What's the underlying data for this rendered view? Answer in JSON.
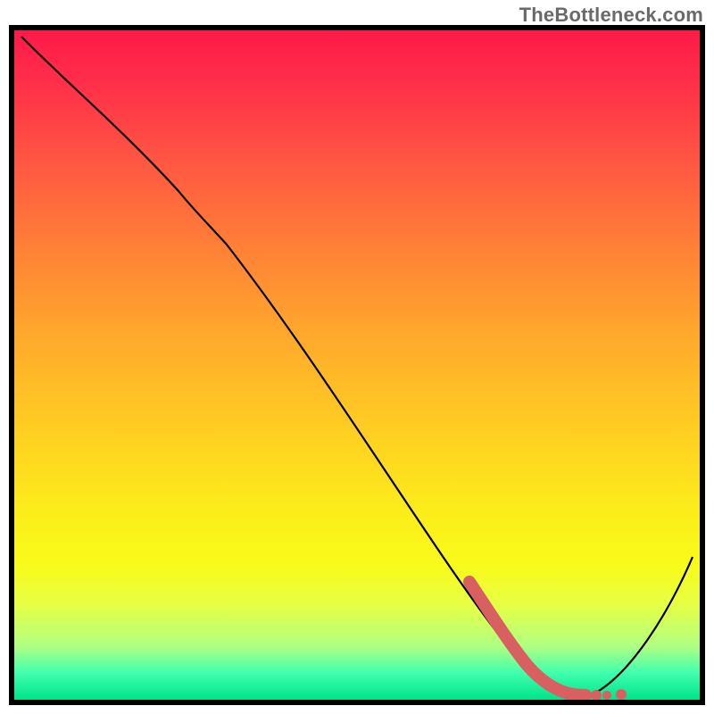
{
  "watermark": "TheBottleneck.com",
  "chart_data": {
    "type": "line",
    "title": "",
    "xlabel": "",
    "ylabel": "",
    "xlim": [
      0,
      100
    ],
    "ylim": [
      0,
      100
    ],
    "grid": false,
    "legend": false,
    "series": [
      {
        "name": "curve",
        "x": [
          1,
          12,
          24,
          36,
          48,
          60,
          72,
          78,
          82,
          86,
          100
        ],
        "y": [
          99,
          87,
          76,
          62,
          45,
          28,
          11,
          3,
          0,
          0,
          22
        ]
      },
      {
        "name": "highlight-band",
        "x": [
          67,
          74,
          78,
          82
        ],
        "y": [
          17,
          5,
          2,
          0
        ]
      },
      {
        "name": "dots",
        "x": [
          84,
          86,
          88
        ],
        "y": [
          0,
          0,
          0
        ]
      }
    ]
  }
}
